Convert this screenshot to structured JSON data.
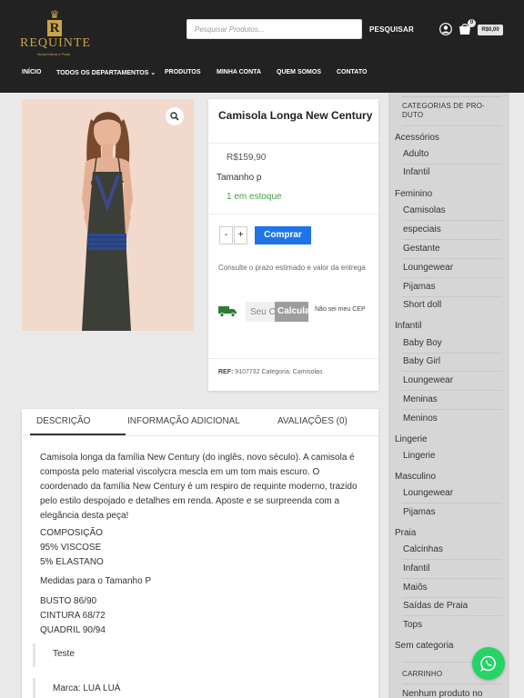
{
  "header": {
    "logo_text": "REQUINTE",
    "logo_tagline": "Moda Íntima e Praia",
    "search_placeholder": "Pesquisar Produtos...",
    "search_button": "PESQUISAR",
    "cart_count": "0",
    "cart_total": "R$0,00"
  },
  "nav": {
    "items": [
      "INÍCIO",
      "TODOS OS DEPARTAMENTOS",
      "PRODUTOS",
      "MINHA CONTA",
      "QUEM SOMOS",
      "CONTATO"
    ]
  },
  "product": {
    "title": "Camisola Longa New Century",
    "price": "R$159,90",
    "size": "Tamanho p",
    "stock": "1 em estoque",
    "qty_minus": "-",
    "qty_plus": "+",
    "buy_label": "Comprar",
    "shipping_info": "Consulte o prazo estimado e valor da entrega",
    "cep_placeholder": "Seu CEP",
    "calc_label": "Calcular",
    "cep_link": "Não sei meu CEP",
    "ref_label": "REF:",
    "ref_value": "9107732",
    "category_label": "Categoria:",
    "category_value": "Camisolas"
  },
  "tabs": {
    "items": [
      "DESCRIÇÃO",
      "INFORMAÇÃO ADICIONAL",
      "AVALIAÇÕES (0)"
    ],
    "description": "Camisola longa da família New Century (do inglês, novo século). A camisola é composta pelo material viscolycra mescla em um tom mais escuro. O coordenado da família New Century é um respiro de requinte moderno, trazido pelo estilo despojado e detalhes em renda. Aposte e se surpreenda com a elegância desta peça!",
    "composition_title": "COMPOSIÇÃO",
    "composition_1": "95% VISCOSE",
    "composition_2": "5% ELASTANO",
    "measures_title": "Medidas para o Tamanho P",
    "bust": "BUSTO 86/90",
    "waist": "CINTURA 68/72",
    "hip": "QUADRIL 90/94",
    "quote_1": "Teste",
    "quote_2": "Marca: LUA LUÁ"
  },
  "sidebar": {
    "categories_title_1": "CATEGORIAS DE PRO-",
    "categories_title_2": "DUTO",
    "items": [
      "Acessórios",
      "Adulto",
      "Infantil",
      "Feminino",
      "Camisolas",
      "especiais",
      "Gestante",
      "Loungewear",
      "Pijamas",
      "Short doll",
      "Infantil",
      "Baby Boy",
      "Baby Girl",
      "Loungewear",
      "Meninas",
      "Meninos",
      "Lingerie",
      "Lingerie",
      "Masculino",
      "Loungewear",
      "Pijamas",
      "Praia",
      "Calcinhas",
      "Infantil",
      "Maiôs",
      "Saídas de Praia",
      "Tops",
      "Sem categoria"
    ],
    "cart_title": "CARRINHO",
    "cart_empty": "Nenhum produto no"
  },
  "colors": {
    "header_bg": "#222222",
    "gold": "#c9a44c",
    "buy_button": "#1e74e8",
    "stock_green": "#43a047",
    "whatsapp_green": "#25d366"
  }
}
